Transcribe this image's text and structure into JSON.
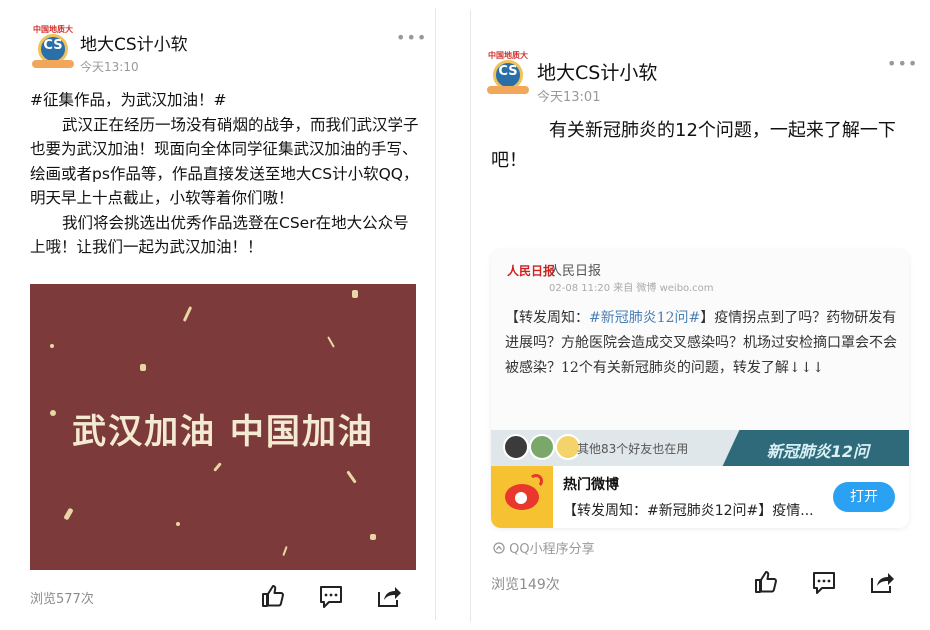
{
  "left": {
    "account_name": "地大CS计小软",
    "time": "今天13:10",
    "avatar_tag": "中国地质大学",
    "avatar_text": "CS",
    "paragraphs": [
      "#征集作品，为武汉加油！#",
      "武汉正在经历一场没有硝烟的战争，而我们武汉学子也要为武汉加油！现面向全体同学征集武汉加油的手写、绘画或者ps作品等，作品直接发送至地大CS计小软QQ，明天早上十点截止，小软等着你们嗷！",
      "我们将会挑选出优秀作品选登在CSer在地大公众号上哦！让我们一起为武汉加油！！"
    ],
    "poster_text": "武汉加油 中国加油",
    "views": "浏览577次",
    "more_icon": "•••"
  },
  "right": {
    "account_name": "地大CS计小软",
    "time": "今天13:01",
    "avatar_tag": "中国地质大学",
    "avatar_text": "CS",
    "text": "有关新冠肺炎的12个问题，一起来了解一下吧！",
    "weibo": {
      "source_logo": "人民日报",
      "source_name": "人民日报",
      "source_meta": "02-08 11:20  来自 微博 weibo.com",
      "post_prefix": "【转发周知：",
      "post_tag": "#新冠肺炎12问#",
      "post_rest": "】疫情拐点到了吗？药物研发有进展吗？方舱医院会造成交叉感染吗？机场过安检摘口罩会不会被感染？12个有关新冠肺炎的问题，转发了解↓↓↓",
      "friends_text": "其他83个好友也在用",
      "banner_title": "新冠肺炎12问",
      "mini_name": "热门微博",
      "mini_desc": "【转发周知：#新冠肺炎12问#】疫情...",
      "open_label": "打开"
    },
    "mini_program_label": "QQ小程序分享",
    "views": "浏览149次",
    "more_icon": "•••"
  },
  "colors": {
    "poster_bg": "#7d3a3a",
    "poster_text": "#f4ead2",
    "open_button": "#2aa1f2",
    "weibo_yellow": "#f6c232",
    "weibo_red": "#e8372c"
  },
  "icons": [
    "thumbs-up-icon",
    "comment-icon",
    "share-icon",
    "more-icon",
    "mini-program-icon"
  ]
}
